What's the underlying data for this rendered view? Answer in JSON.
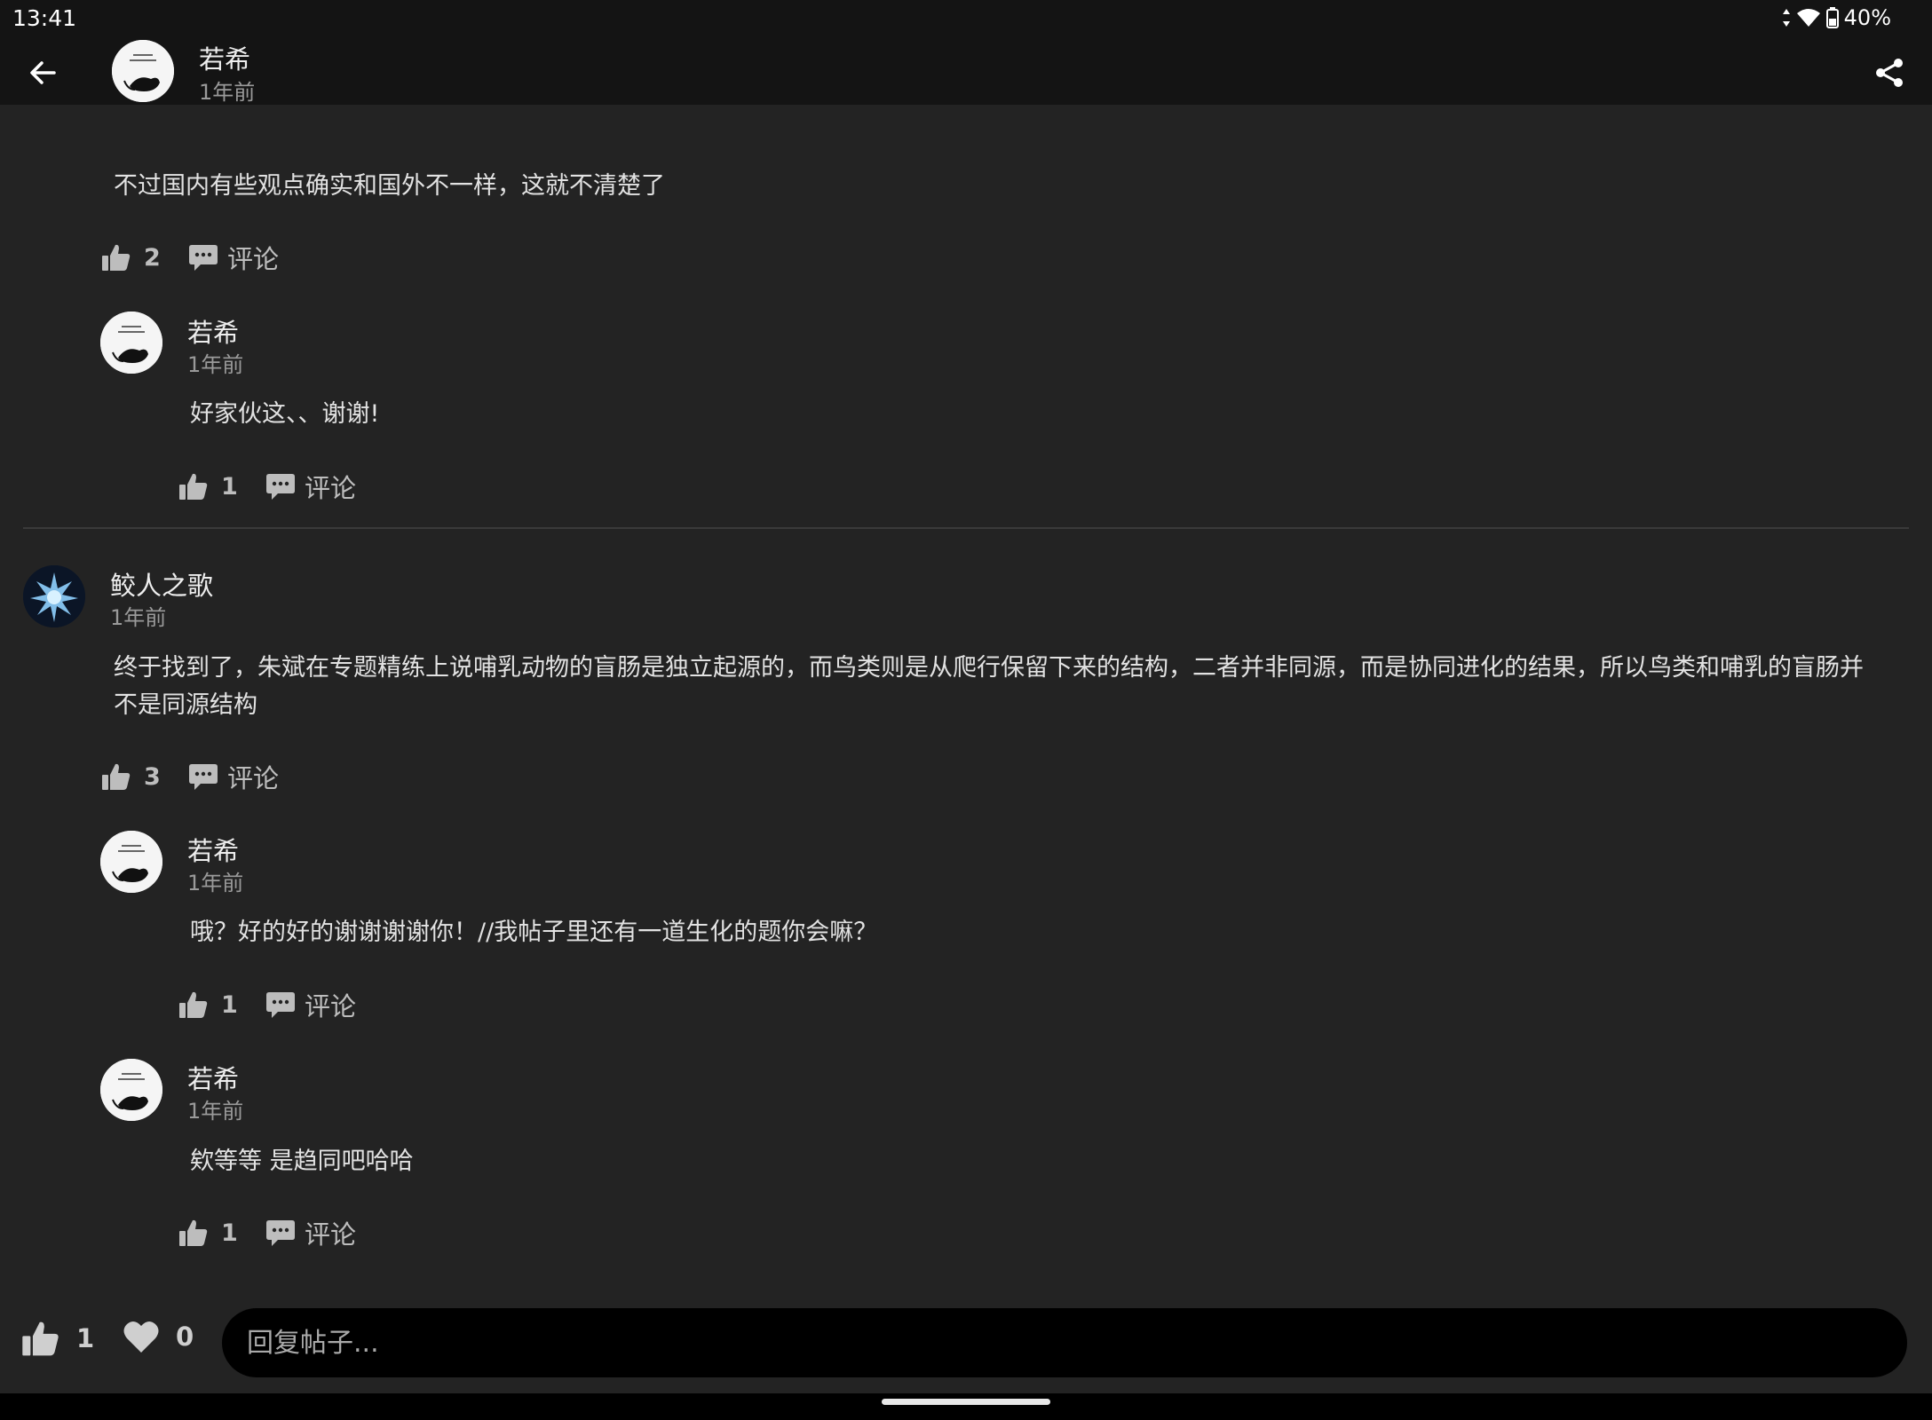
{
  "status_bar": {
    "time": "13:41",
    "battery": "40%",
    "icons": [
      "data-arrows-icon",
      "wifi-icon",
      "battery-icon"
    ]
  },
  "header": {
    "back_icon": "arrow-left-icon",
    "author": "若希",
    "time": "1年前",
    "share_icon": "share-icon"
  },
  "comments": [
    {
      "text": "不过国内有些观点确实和国外不一样，这就不清楚了",
      "likes": "2",
      "comment_label": "评论",
      "replies": [
        {
          "author": "若希",
          "time": "1年前",
          "text": "好家伙这、、谢谢!",
          "likes": "1",
          "comment_label": "评论"
        }
      ]
    },
    {
      "author": "鲛人之歌",
      "time": "1年前",
      "text": "终于找到了，朱斌在专题精练上说哺乳动物的盲肠是独立起源的，而鸟类则是从爬行保留下来的结构，二者并非同源，而是协同进化的结果，所以鸟类和哺乳的盲肠并不是同源结构",
      "likes": "3",
      "comment_label": "评论",
      "replies": [
        {
          "author": "若希",
          "time": "1年前",
          "text": "哦？好的好的谢谢谢谢你！//我帖子里还有一道生化的题你会嘛？",
          "likes": "1",
          "comment_label": "评论"
        },
        {
          "author": "若希",
          "time": "1年前",
          "text": "欸等等 是趋同吧哈哈",
          "likes": "1",
          "comment_label": "评论"
        }
      ]
    }
  ],
  "bottom_bar": {
    "likes": "1",
    "favorites": "0",
    "reply_placeholder": "回复帖子..."
  },
  "colors": {
    "background": "#232323",
    "header_bg": "#141414",
    "icon_gray": "#bdbdbd",
    "input_bg": "#000000"
  }
}
